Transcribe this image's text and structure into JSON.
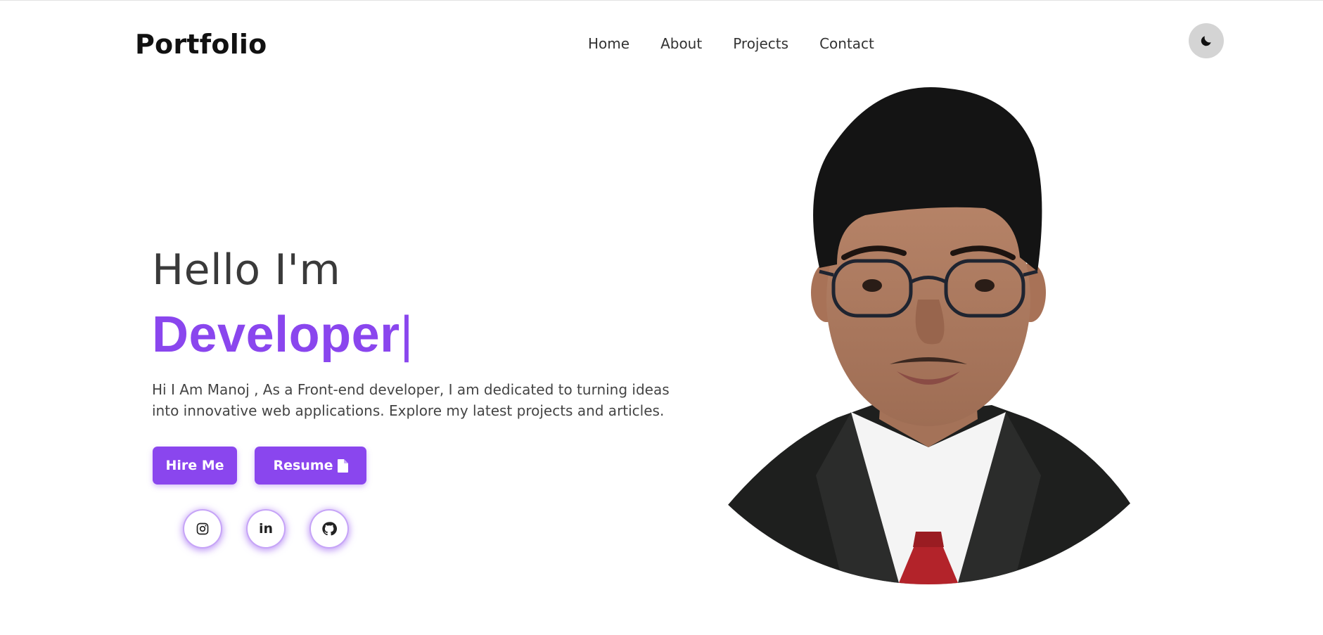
{
  "header": {
    "logo": "Portfolio",
    "nav": [
      "Home",
      "About",
      "Projects",
      "Contact"
    ],
    "theme_toggle_icon": "moon-icon"
  },
  "hero": {
    "greeting": "Hello I'm",
    "role": "Developer",
    "caret": "|",
    "intro": "Hi I Am Manoj , As a Front-end developer, I am dedicated to turning ideas into innovative web applications. Explore my latest projects and articles.",
    "buttons": {
      "hire": "Hire Me",
      "resume": "Resume",
      "resume_icon": "file-icon"
    },
    "social": {
      "instagram_icon": "instagram-icon",
      "linkedin_text": "in",
      "github_icon": "github-icon"
    }
  },
  "colors": {
    "accent": "#8a46ee",
    "text": "#333333",
    "background": "#ffffff",
    "toggle": "#d4d4d4"
  }
}
